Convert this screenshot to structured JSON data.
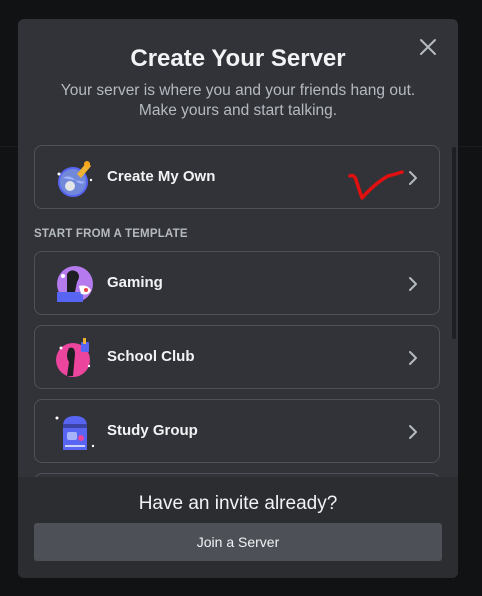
{
  "modal": {
    "title": "Create Your Server",
    "subtitle": "Your server is where you and your friends hang out. Make yours and start talking."
  },
  "options": {
    "create_own": {
      "label": "Create My Own",
      "icon": "globe-rocket-icon"
    },
    "section_label": "START FROM A TEMPLATE",
    "templates": [
      {
        "label": "Gaming",
        "icon": "gaming-icon"
      },
      {
        "label": "School Club",
        "icon": "school-club-icon"
      },
      {
        "label": "Study Group",
        "icon": "study-group-icon"
      }
    ]
  },
  "footer": {
    "title": "Have an invite already?",
    "join_label": "Join a Server"
  },
  "colors": {
    "modal_bg": "#313338",
    "footer_bg": "#2b2d31",
    "button_bg": "#4e5058",
    "annotation_red": "#e01010"
  }
}
